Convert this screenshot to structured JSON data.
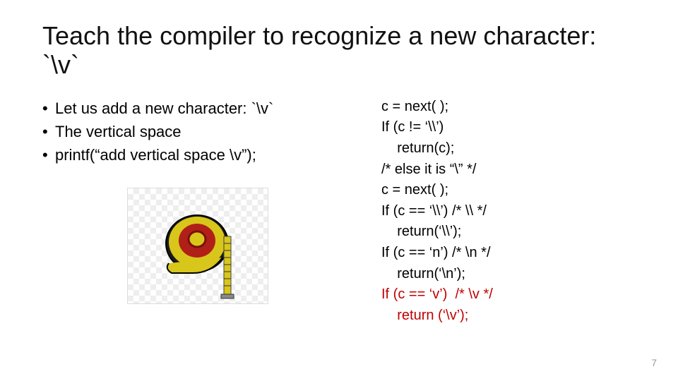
{
  "title": "Teach the compiler to recognize a new character: `\\v`",
  "bullets": [
    "Let us add a new character: `\\v`",
    "The vertical space",
    "printf(“add vertical space \\v”);"
  ],
  "image": {
    "alt": "tape-measure"
  },
  "code": {
    "l1": "c = next( );",
    "l2": "If (c != ‘\\\\’)",
    "l3": "    return(c);",
    "l4": "/* else it is “\\” */",
    "l5": "c = next( );",
    "l6": "If (c == ‘\\\\’) /* \\\\ */",
    "l7": "    return(‘\\\\’);",
    "l8": "If (c == ‘n’) /* \\n */",
    "l9": "    return(‘\\n’);",
    "l10": "If (c == ‘v’)  /* \\v */",
    "l11": "    return (‘\\v’);"
  },
  "page_number": "7"
}
